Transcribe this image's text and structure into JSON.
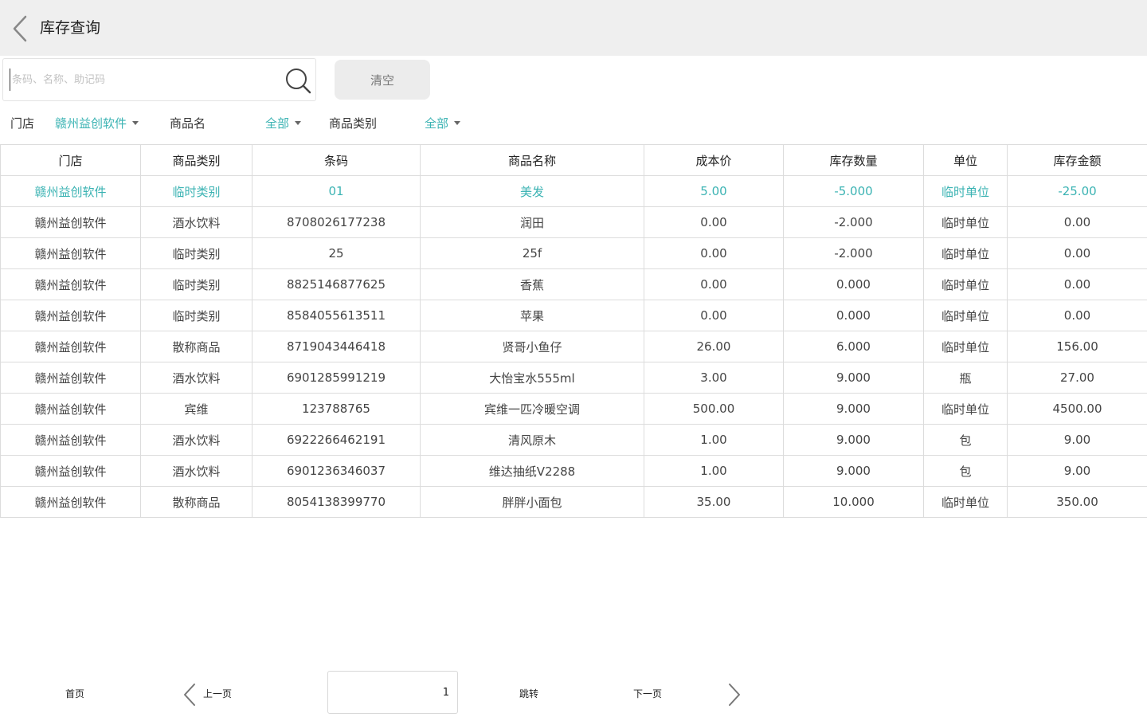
{
  "header": {
    "title": "库存查询"
  },
  "search": {
    "placeholder": "条码、名称、助记码",
    "value": ""
  },
  "clear_button": "清空",
  "filters": {
    "store_label": "门店",
    "store_value": "赣州益创软件",
    "product_name_label": "商品名",
    "product_name_value": "全部",
    "category_label": "商品类别",
    "category_value": "全部"
  },
  "table": {
    "headers": [
      "门店",
      "商品类别",
      "条码",
      "商品名称",
      "成本价",
      "库存数量",
      "单位",
      "库存金额"
    ],
    "rows": [
      [
        "赣州益创软件",
        "临时类别",
        "01",
        "美发",
        "5.00",
        "-5.000",
        "临时单位",
        "-25.00"
      ],
      [
        "赣州益创软件",
        "酒水饮料",
        "8708026177238",
        "润田",
        "0.00",
        "-2.000",
        "临时单位",
        "0.00"
      ],
      [
        "赣州益创软件",
        "临时类别",
        "25",
        "25f",
        "0.00",
        "-2.000",
        "临时单位",
        "0.00"
      ],
      [
        "赣州益创软件",
        "临时类别",
        "8825146877625",
        "香蕉",
        "0.00",
        "0.000",
        "临时单位",
        "0.00"
      ],
      [
        "赣州益创软件",
        "临时类别",
        "8584055613511",
        "苹果",
        "0.00",
        "0.000",
        "临时单位",
        "0.00"
      ],
      [
        "赣州益创软件",
        "散称商品",
        "8719043446418",
        "贤哥小鱼仔",
        "26.00",
        "6.000",
        "临时单位",
        "156.00"
      ],
      [
        "赣州益创软件",
        "酒水饮料",
        "6901285991219",
        "大怡宝水555ml",
        "3.00",
        "9.000",
        "瓶",
        "27.00"
      ],
      [
        "赣州益创软件",
        "宾维",
        "123788765",
        "宾维一匹冷暖空调",
        "500.00",
        "9.000",
        "临时单位",
        "4500.00"
      ],
      [
        "赣州益创软件",
        "酒水饮料",
        "6922266462191",
        "清风原木",
        "1.00",
        "9.000",
        "包",
        "9.00"
      ],
      [
        "赣州益创软件",
        "酒水饮料",
        "6901236346037",
        "维达抽纸V2288",
        "1.00",
        "9.000",
        "包",
        "9.00"
      ],
      [
        "赣州益创软件",
        "散称商品",
        "8054138399770",
        "胖胖小面包",
        "35.00",
        "10.000",
        "临时单位",
        "350.00"
      ]
    ],
    "selected_row_index": 0
  },
  "pager": {
    "first": "首页",
    "prev": "上一页",
    "page_value": "1",
    "jump": "跳转",
    "next": "下一页"
  },
  "colors": {
    "accent": "#3bb3b3",
    "header_bg": "#efefef",
    "border": "#dcdcdc"
  },
  "icons": [
    "back-arrow-icon",
    "search-icon",
    "caret-down-icon",
    "chevron-left-icon",
    "chevron-right-icon"
  ]
}
